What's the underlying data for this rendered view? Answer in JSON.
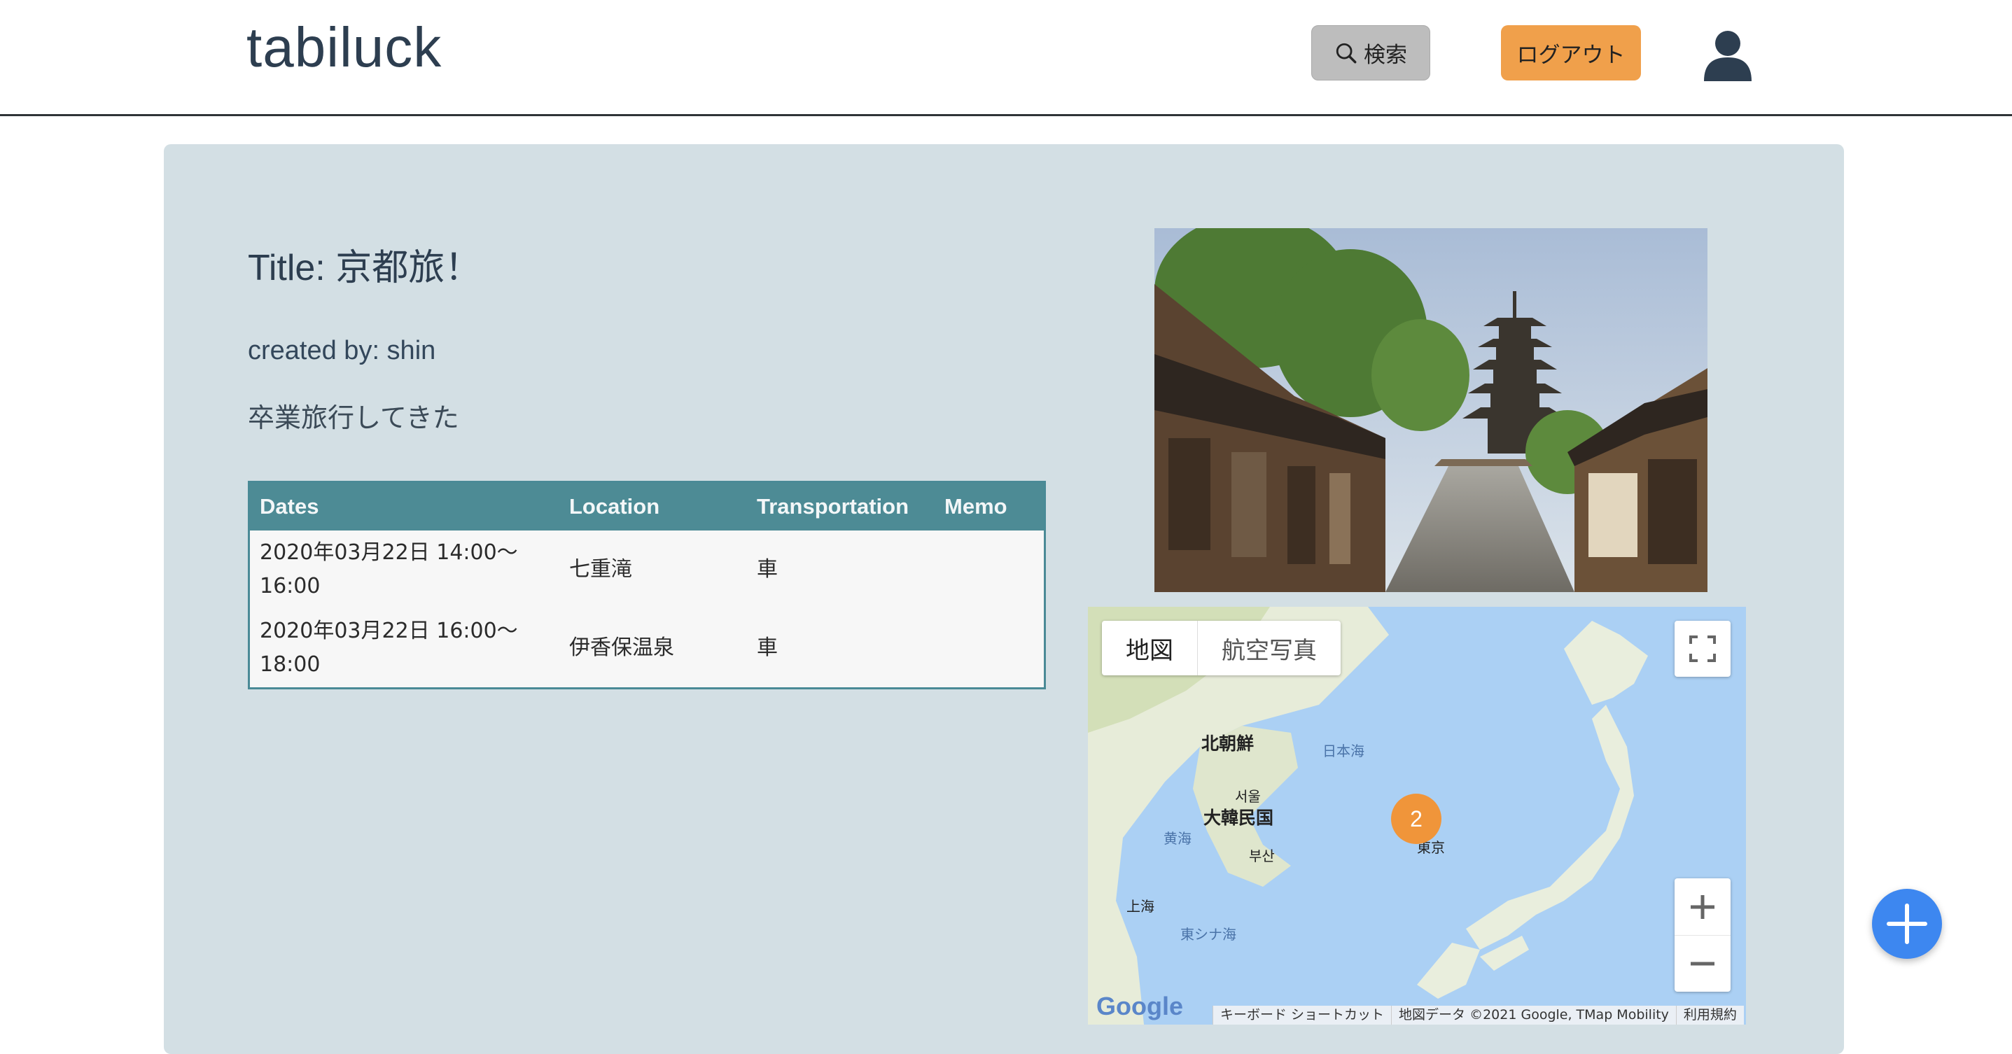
{
  "header": {
    "logo": "tabiluck",
    "search_label": "検索",
    "logout_label": "ログアウト"
  },
  "post": {
    "title": "Title: 京都旅！",
    "author": "created by: shin",
    "description": "卒業旅行してきた"
  },
  "table": {
    "headers": [
      "Dates",
      "Location",
      "Transportation",
      "Memo"
    ],
    "rows": [
      {
        "date_line1": "2020年03月22日 14:00〜",
        "date_line2": "16:00",
        "location": "七重滝",
        "transport": "車",
        "memo": ""
      },
      {
        "date_line1": "2020年03月22日 16:00〜",
        "date_line2": "18:00",
        "location": "伊香保温泉",
        "transport": "車",
        "memo": ""
      }
    ]
  },
  "map": {
    "type_map": "地図",
    "type_satellite": "航空写真",
    "marker_count": "2",
    "labels": {
      "north_korea": "北朝鮮",
      "seoul": "서울",
      "south_korea": "大韓民国",
      "busan": "부산",
      "sea_of_japan": "日本海",
      "yellow_sea": "黄海",
      "shanghai": "上海",
      "east_china_sea": "東シナ海",
      "tokyo": "東京"
    },
    "google_logo": "Google",
    "footer": {
      "shortcuts": "キーボード ショートカット",
      "data": "地図データ ©2021 Google, TMap Mobility",
      "terms": "利用規約"
    }
  },
  "colors": {
    "panel_bg": "#d3dfe4",
    "table_header": "#4d8b95",
    "logout_btn": "#f0a04b",
    "search_btn": "#bdbdbd",
    "fab": "#3d87f0",
    "marker": "#f0953a"
  }
}
